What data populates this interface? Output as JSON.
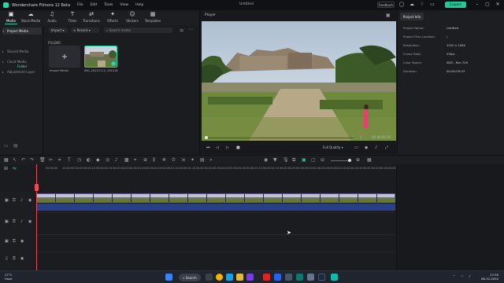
{
  "titlebar": {
    "app_title": "Wondershare Filmora 12 Beta",
    "menus": [
      "File",
      "Edit",
      "Tools",
      "View",
      "Help"
    ],
    "project_title": "Untitled",
    "feedback_label": "Feedback",
    "export_label": "Export",
    "colors": {
      "accent": "#22c994"
    }
  },
  "toolbar": {
    "tabs": [
      {
        "label": "Media",
        "icon": "media-icon",
        "glyph": "▣"
      },
      {
        "label": "Stock Media",
        "icon": "stock-media-icon",
        "glyph": "☁"
      },
      {
        "label": "Audio",
        "icon": "audio-icon",
        "glyph": "♫"
      },
      {
        "label": "Titles",
        "icon": "titles-icon",
        "glyph": "T"
      },
      {
        "label": "Transitions",
        "icon": "transitions-icon",
        "glyph": "⇄"
      },
      {
        "label": "Effects",
        "icon": "effects-icon",
        "glyph": "✦"
      },
      {
        "label": "Stickers",
        "icon": "stickers-icon",
        "glyph": "☺"
      },
      {
        "label": "Templates",
        "icon": "templates-icon",
        "glyph": "▦"
      }
    ]
  },
  "sidebar": {
    "items": [
      {
        "label": "Project Media"
      },
      {
        "label": "Shared Media"
      },
      {
        "label": "Cloud Media"
      },
      {
        "label": "Adjustment Layer"
      }
    ],
    "sub_label": "Folder"
  },
  "browser": {
    "import_dropdown": "Import",
    "sort_dropdown": "Record",
    "search_placeholder": "Search media",
    "folder_label": "FOLDER",
    "import_tile_label": "Import Media",
    "clip_label": "IMG_20221112_154416"
  },
  "player": {
    "title": "Player",
    "timecode": "00:00:00:00",
    "quality": "Full Quality"
  },
  "project_info": {
    "tab": "Project Info",
    "rows": [
      {
        "label": "Project Name:",
        "value": "Untitled"
      },
      {
        "label": "Project Files Location:",
        "value": "/"
      },
      {
        "label": "Resolution:",
        "value": "1920 x 1080"
      },
      {
        "label": "Frame Rate:",
        "value": "25fps"
      },
      {
        "label": "Color Space:",
        "value": "SDR - Rec.709"
      },
      {
        "label": "Duration:",
        "value": "00:00:09:03"
      }
    ]
  },
  "timeline": {
    "ruler": [
      "00:00:00",
      "00:00:00:05",
      "00:00:00:10",
      "00:00:00:15",
      "00:00:00:20",
      "00:00:01:00",
      "00:00:01:05",
      "00:00:01:10",
      "00:00:01:15",
      "00:00:01:20",
      "00:00:02:00",
      "00:00:02:05",
      "00:00:02:10",
      "00:00:02:15",
      "00:00:02:20",
      "00:00:03:00",
      "00:00:03:05",
      "00:00:03:10",
      "00:00:03:15",
      "00:00:03:20",
      "00:00:04:00"
    ],
    "colors": {
      "playhead": "#e84b5a",
      "audio": "#2a3f8a"
    }
  },
  "taskbar": {
    "weather_temp": "27°C",
    "weather_text": "Haze",
    "search_label": "Search",
    "time": "17:50",
    "date": "06-12-2022"
  }
}
